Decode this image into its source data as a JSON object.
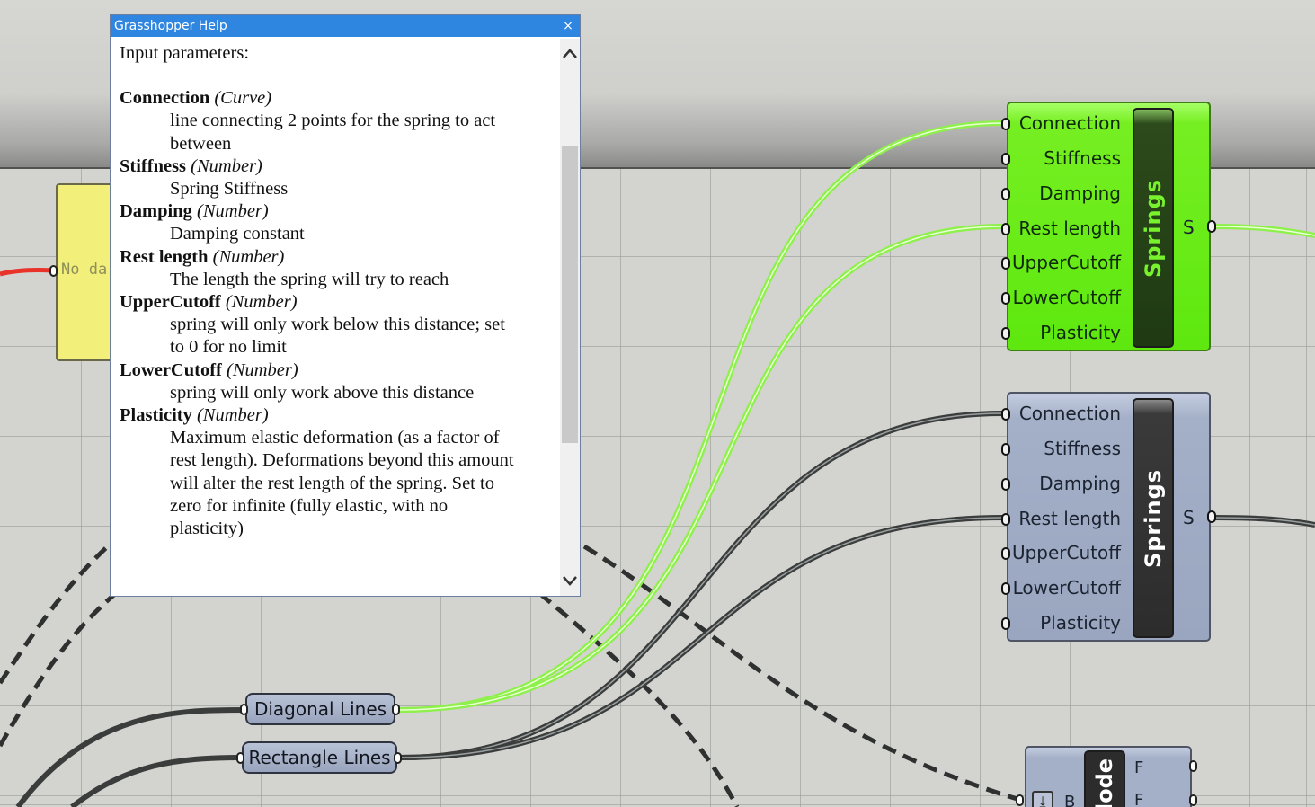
{
  "help": {
    "title": "Grasshopper Help",
    "close": "×",
    "heading": "Input parameters:",
    "params": [
      {
        "name": "Connection",
        "type": "(Curve)",
        "desc": [
          "line connecting 2 points for the spring to act",
          "between"
        ]
      },
      {
        "name": "Stiffness",
        "type": "(Number)",
        "desc": [
          "Spring Stiffness"
        ]
      },
      {
        "name": "Damping",
        "type": "(Number)",
        "desc": [
          "Damping constant"
        ]
      },
      {
        "name": "Rest length",
        "type": "(Number)",
        "desc": [
          "The length the spring will try to reach"
        ]
      },
      {
        "name": "UpperCutoff",
        "type": "(Number)",
        "desc": [
          "spring will only work below this distance; set",
          "to 0 for no limit"
        ]
      },
      {
        "name": "LowerCutoff",
        "type": "(Number)",
        "desc": [
          "spring will only work above this distance"
        ]
      },
      {
        "name": "Plasticity",
        "type": "(Number)",
        "desc": [
          "Maximum elastic deformation (as a factor of",
          "rest length). Deformations beyond this amount",
          "will alter the rest length of the spring. Set to",
          "zero for infinite (fully elastic, with no",
          "plasticity)"
        ]
      }
    ],
    "scroll_up_icon": "chevron-up-icon",
    "scroll_down_icon": "chevron-down-icon"
  },
  "yellow_panel": {
    "text": "No da"
  },
  "components": {
    "springs_green": {
      "label": "Springs",
      "inputs": [
        "Connection",
        "Stiffness",
        "Damping",
        "Rest length",
        "UpperCutoff",
        "LowerCutoff",
        "Plasticity"
      ],
      "output": "S",
      "color": "#5ee80f"
    },
    "springs_gray": {
      "label": "Springs",
      "inputs": [
        "Connection",
        "Stiffness",
        "Damping",
        "Rest length",
        "UpperCutoff",
        "LowerCutoff",
        "Plasticity"
      ],
      "output": "S",
      "color": "#9aa6bf"
    }
  },
  "params_nodes": {
    "diagonal": "Diagonal Lines",
    "rectangle": "Rectangle Lines"
  },
  "node_partial": {
    "label": "lode",
    "outputs": [
      "F",
      "F"
    ],
    "input": "B",
    "button_icon": "arrow-down-icon"
  },
  "colors": {
    "wire_selected": "#8ef04a",
    "wire_default": "#3a3d3c",
    "wire_error": "#e8322a",
    "title_bar": "#2f86e0"
  }
}
